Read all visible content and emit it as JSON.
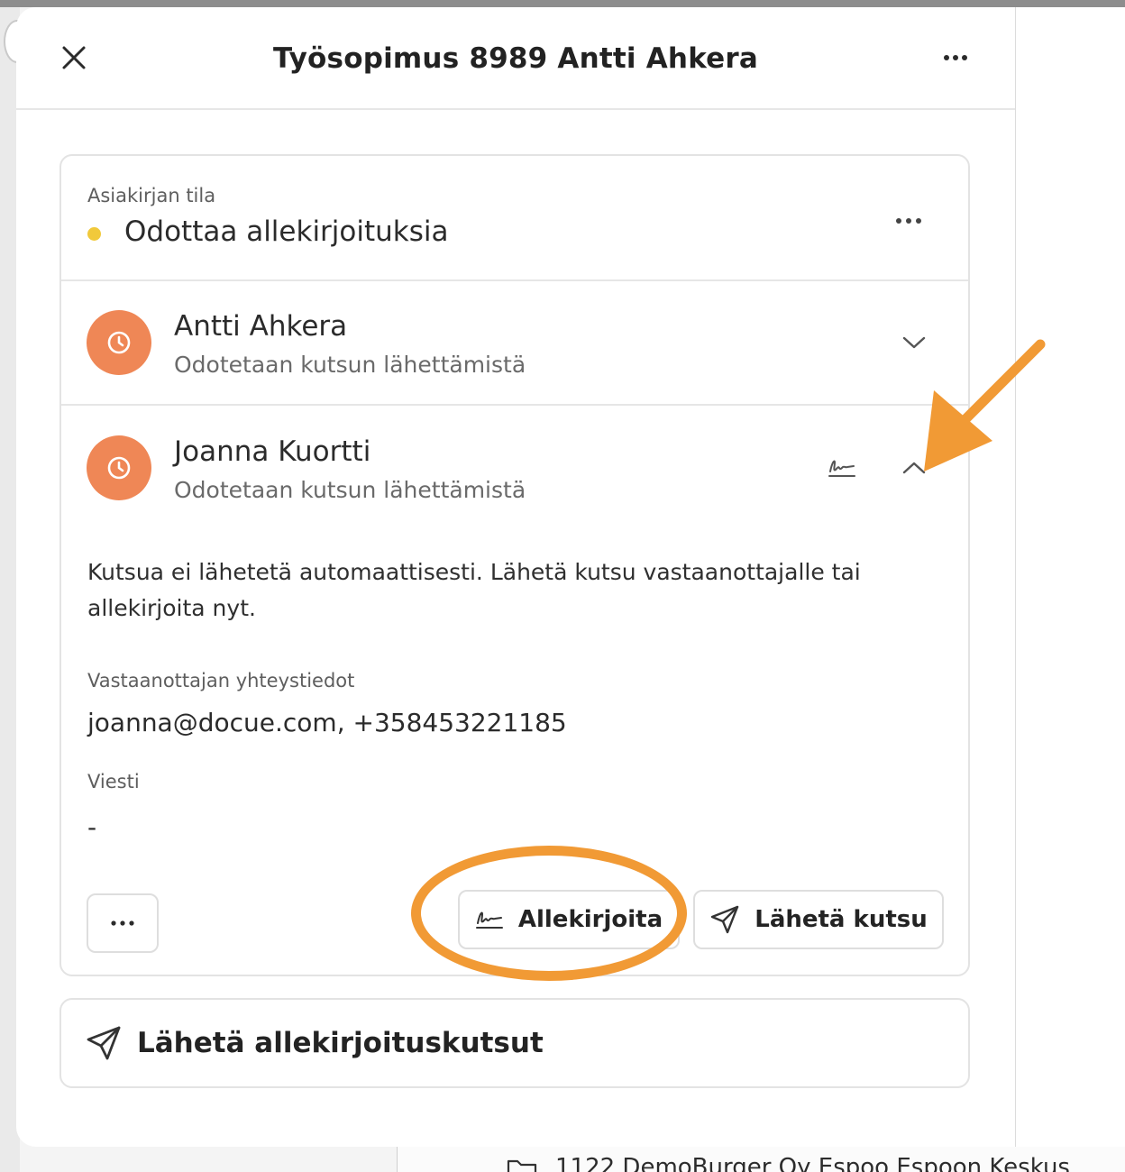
{
  "modal": {
    "title": "Työsopimus 8989 Antti Ahkera"
  },
  "status": {
    "label": "Asiakirjan tila",
    "value": "Odottaa allekirjoituksia",
    "dot_color": "#f1c93b"
  },
  "signers": [
    {
      "name": "Antti Ahkera",
      "status": "Odotetaan kutsun lähettämistä",
      "expanded": false
    },
    {
      "name": "Joanna Kuortti",
      "status": "Odotetaan kutsun lähettämistä",
      "expanded": true,
      "details": {
        "info": "Kutsua ei lähetetä automaattisesti. Lähetä kutsu vastaanottajalle tai allekirjoita nyt.",
        "contact_label": "Vastaanottajan yhteystiedot",
        "contact_value": "joanna@docue.com, +358453221185",
        "message_label": "Viesti",
        "message_value": "-",
        "sign_button": "Allekirjoita",
        "invite_button": "Lähetä kutsu"
      }
    }
  ],
  "actions": {
    "send_all": "Lähetä allekirjoituskutsut"
  },
  "background": {
    "folder_row": "1122 DemoBurger Oy Espoo Espoon Keskus"
  },
  "colors": {
    "accent_orange": "#f19a35",
    "avatar_orange": "#ef8756",
    "status_yellow": "#f1c93b"
  },
  "icons": {
    "close": "close-icon",
    "more": "more-horizontal-icon",
    "avatar": "clock-icon",
    "expand": "chevron-down-icon",
    "collapse": "chevron-up-icon",
    "signature": "signature-icon",
    "send": "send-icon",
    "folder": "folder-icon"
  }
}
